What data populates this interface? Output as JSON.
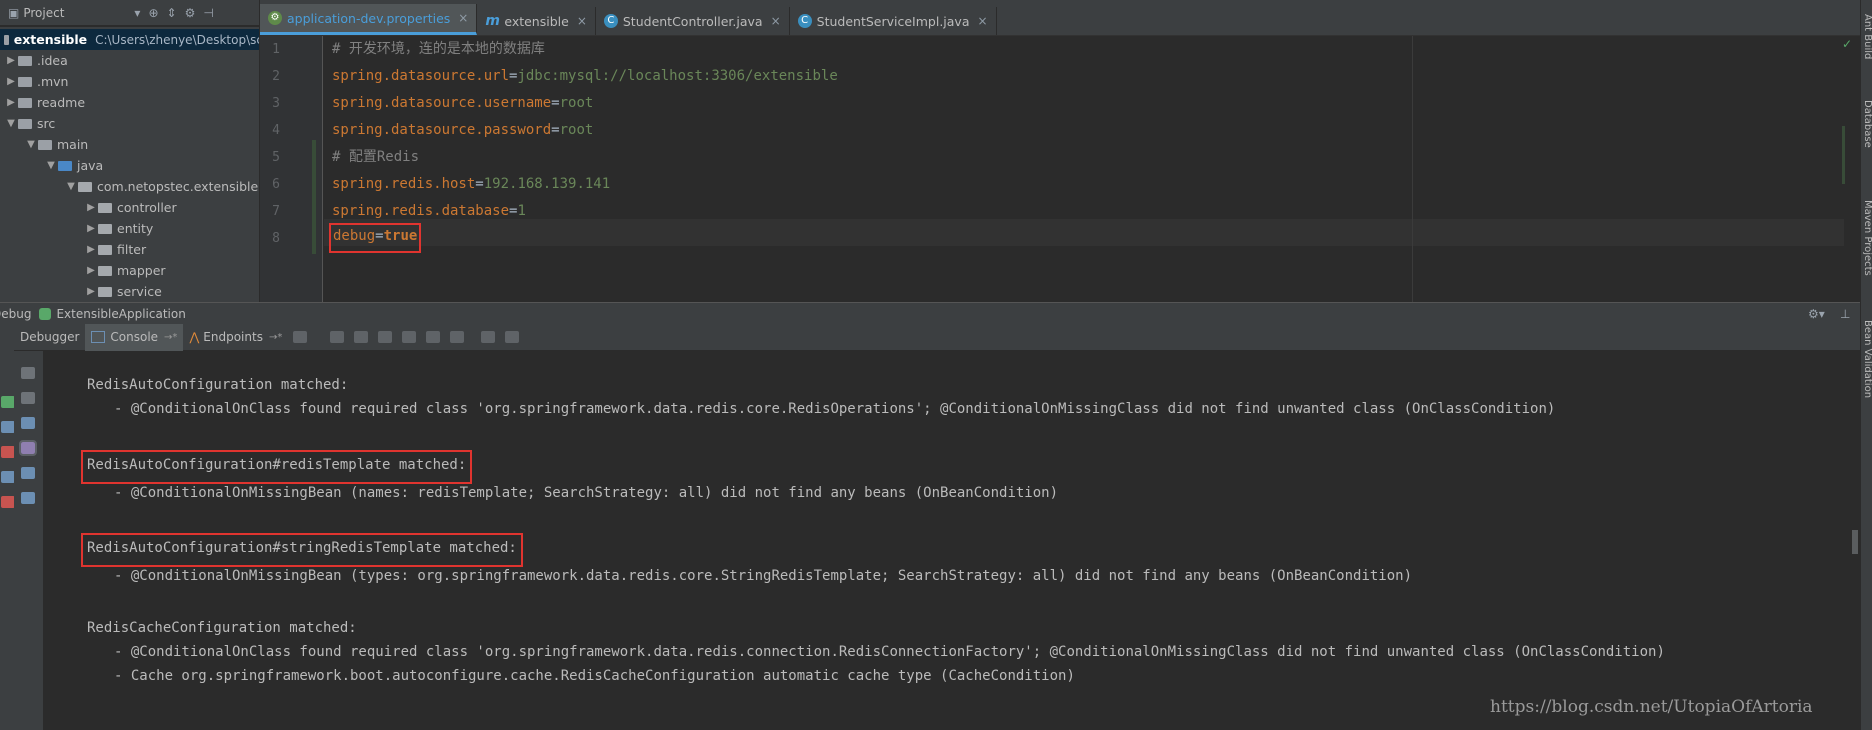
{
  "project_panel": {
    "title": "Project",
    "tree": [
      {
        "label": "extensible",
        "path": "C:\\Users\\zhenye\\Desktop\\sc"
      },
      {
        "label": ".idea"
      },
      {
        "label": ".mvn"
      },
      {
        "label": "readme"
      },
      {
        "label": "src"
      },
      {
        "label": "main"
      },
      {
        "label": "java"
      },
      {
        "label": "com.netopstec.extensible"
      },
      {
        "label": "controller"
      },
      {
        "label": "entity"
      },
      {
        "label": "filter"
      },
      {
        "label": "mapper"
      },
      {
        "label": "service"
      }
    ]
  },
  "editor": {
    "tabs": [
      {
        "label": "application-dev.properties",
        "icon": "properties-file-icon",
        "active": true
      },
      {
        "label": "extensible",
        "icon": "maven-icon",
        "active": false
      },
      {
        "label": "StudentController.java",
        "icon": "java-class-icon",
        "active": false
      },
      {
        "label": "StudentServiceImpl.java",
        "icon": "java-class-icon",
        "active": false
      }
    ],
    "line_numbers": [
      "1",
      "2",
      "3",
      "4",
      "5",
      "6",
      "7",
      "8"
    ],
    "lines": {
      "l1": "# 开发环境，连的是本地的数据库",
      "l2_key": "spring.datasource.url",
      "l2_val": "jdbc:mysql://localhost:3306/extensible",
      "l3_key": "spring.datasource.username",
      "l3_val": "root",
      "l4_key": "spring.datasource.password",
      "l4_val": "root",
      "l5": "# 配置Redis",
      "l6_key": "spring.redis.host",
      "l6_val": "192.168.139.141",
      "l7_key": "spring.redis.database",
      "l7_val": "1",
      "l8_key": "debug",
      "l8_val": "true"
    },
    "eq": "="
  },
  "right_stripe": [
    "Ant Build",
    "Database",
    "Maven Projects",
    "Bean Validation"
  ],
  "debug": {
    "title_prefix": "Debug",
    "config": "ExtensibleApplication",
    "tabs": [
      {
        "label": "Debugger"
      },
      {
        "label": "Console",
        "suffix": "→*"
      },
      {
        "label": "Endpoints",
        "suffix": "→*"
      }
    ],
    "console_lines": [
      "RedisAutoConfiguration matched:",
      "- @ConditionalOnClass found required class 'org.springframework.data.redis.core.RedisOperations'; @ConditionalOnMissingClass did not find unwanted class (OnClassCondition)",
      "RedisAutoConfiguration#redisTemplate matched:",
      "- @ConditionalOnMissingBean (names: redisTemplate; SearchStrategy: all) did not find any beans (OnBeanCondition)",
      "RedisAutoConfiguration#stringRedisTemplate matched:",
      "- @ConditionalOnMissingBean (types: org.springframework.data.redis.core.StringRedisTemplate; SearchStrategy: all) did not find any beans (OnBeanCondition)",
      "RedisCacheConfiguration matched:",
      "- @ConditionalOnClass found required class 'org.springframework.data.redis.connection.RedisConnectionFactory'; @ConditionalOnMissingClass did not find unwanted class (OnClassCondition)",
      "- Cache org.springframework.boot.autoconfigure.cache.RedisCacheConfiguration automatic cache type (CacheCondition)"
    ]
  },
  "watermark": "https://blog.csdn.net/UtopiaOfArtoria",
  "colors": {
    "highlight_box": "#e0342f",
    "accent": "#4a9eda"
  }
}
